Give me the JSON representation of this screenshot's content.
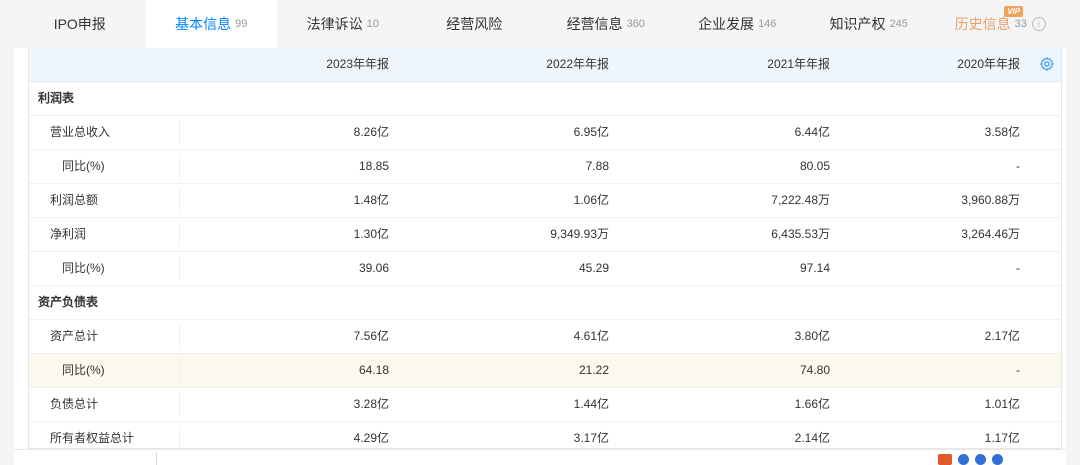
{
  "tabs": [
    {
      "label": "IPO申报",
      "count": ""
    },
    {
      "label": "基本信息",
      "count": "99",
      "active": true
    },
    {
      "label": "法律诉讼",
      "count": "10"
    },
    {
      "label": "经营风险",
      "count": ""
    },
    {
      "label": "经营信息",
      "count": "360"
    },
    {
      "label": "企业发展",
      "count": "146"
    },
    {
      "label": "知识产权",
      "count": "245"
    },
    {
      "label": "历史信息",
      "count": "33",
      "vip_badge": "VIP"
    }
  ],
  "table": {
    "columns": [
      "2023年年报",
      "2022年年报",
      "2021年年报",
      "2020年年报"
    ],
    "rows": [
      {
        "type": "section",
        "label": "利润表"
      },
      {
        "type": "row",
        "label": "营业总收入",
        "values": [
          "8.26亿",
          "6.95亿",
          "6.44亿",
          "3.58亿"
        ]
      },
      {
        "type": "sub",
        "label": "同比(%)",
        "values": [
          "18.85",
          "7.88",
          "80.05",
          "-"
        ]
      },
      {
        "type": "row",
        "label": "利润总额",
        "values": [
          "1.48亿",
          "1.06亿",
          "7,222.48万",
          "3,960.88万"
        ]
      },
      {
        "type": "row",
        "label": "净利润",
        "values": [
          "1.30亿",
          "9,349.93万",
          "6,435.53万",
          "3,264.46万"
        ]
      },
      {
        "type": "sub",
        "label": "同比(%)",
        "values": [
          "39.06",
          "45.29",
          "97.14",
          "-"
        ]
      },
      {
        "type": "section",
        "label": "资产负债表"
      },
      {
        "type": "row",
        "label": "资产总计",
        "values": [
          "7.56亿",
          "4.61亿",
          "3.80亿",
          "2.17亿"
        ]
      },
      {
        "type": "sub",
        "label": "同比(%)",
        "values": [
          "64.18",
          "21.22",
          "74.80",
          "-"
        ],
        "highlight": true
      },
      {
        "type": "row",
        "label": "负债总计",
        "values": [
          "3.28亿",
          "1.44亿",
          "1.66亿",
          "1.01亿"
        ]
      },
      {
        "type": "row",
        "label": "所有者权益总计",
        "values": [
          "4.29亿",
          "3.17亿",
          "2.14亿",
          "1.17亿"
        ]
      }
    ]
  },
  "colors": {
    "accent": "#0084ff",
    "header_bg": "#eef6fc",
    "highlight_bg": "#fdf8ee",
    "vip": "#e8a06a"
  },
  "icons": {
    "settings": "gear-icon",
    "info": "info-icon"
  }
}
